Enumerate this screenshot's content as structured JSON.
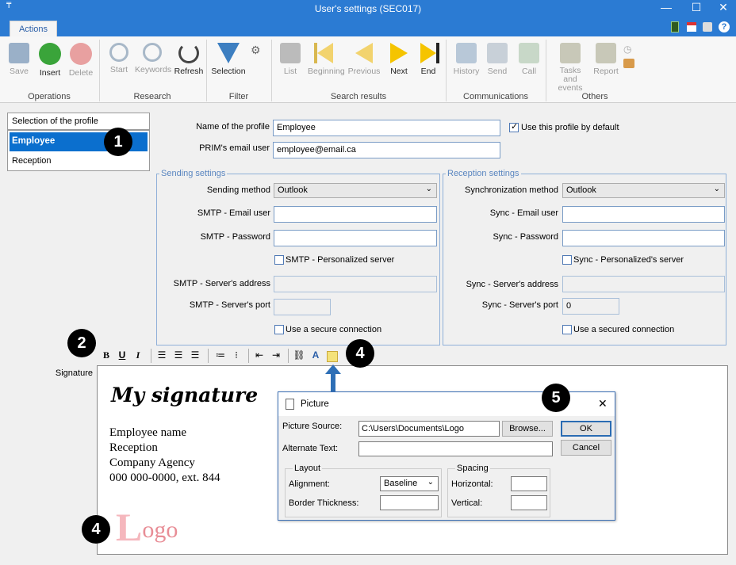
{
  "window": {
    "title": "User's settings (SEC017)",
    "minimize": "—",
    "maximize": "☐",
    "close": "✕"
  },
  "ribbon": {
    "tab": "Actions",
    "buttons": [
      {
        "label": "Save",
        "icon": "save-icon"
      },
      {
        "label": "Insert",
        "icon": "plus-circle-icon"
      },
      {
        "label": "Delete",
        "icon": "x-circle-icon"
      },
      {
        "label": "Start",
        "icon": "magnifier-icon"
      },
      {
        "label": "Keywords",
        "icon": "keyword-search-icon"
      },
      {
        "label": "Refresh",
        "icon": "refresh-icon"
      },
      {
        "label": "Selection",
        "icon": "funnel-icon"
      },
      {
        "label": "List",
        "icon": "scroll-icon"
      },
      {
        "label": "Beginning",
        "icon": "first-icon"
      },
      {
        "label": "Previous",
        "icon": "previous-icon"
      },
      {
        "label": "Next",
        "icon": "next-icon"
      },
      {
        "label": "End",
        "icon": "last-icon"
      },
      {
        "label": "History",
        "icon": "history-icon"
      },
      {
        "label": "Send",
        "icon": "envelope-icon"
      },
      {
        "label": "Call",
        "icon": "phone-icon"
      },
      {
        "label": "Tasks and events",
        "icon": "clipboard-icon"
      },
      {
        "label": "Report",
        "icon": "report-icon"
      }
    ],
    "groups": [
      "Operations",
      "Research",
      "Filter",
      "Search results",
      "Communications",
      "Others"
    ]
  },
  "profiles": {
    "header": "Selection of the profile",
    "items": [
      "Employee",
      "Reception"
    ],
    "selected": "Employee"
  },
  "form": {
    "name_label": "Name of the profile",
    "name_value": "Employee",
    "default_label": "Use this profile by default",
    "email_label": "PRIM's email user",
    "email_value": "employee@email.ca"
  },
  "sending": {
    "legend": "Sending settings",
    "method_label": "Sending method",
    "method_value": "Outlook",
    "user_label": "SMTP - Email user",
    "password_label": "SMTP - Password",
    "personalized_label": "SMTP - Personalized server",
    "address_label": "SMTP - Server's address",
    "port_label": "SMTP - Server's port",
    "secure_label": "Use a secure connection"
  },
  "reception": {
    "legend": "Reception settings",
    "method_label": "Synchronization method",
    "method_value": "Outlook",
    "user_label": "Sync - Email user",
    "password_label": "Sync - Password",
    "personalized_label": "Sync - Personalized's server",
    "address_label": "Sync - Server's address",
    "port_label": "Sync - Server's port",
    "port_value": "0",
    "secure_label": "Use a secured connection"
  },
  "signature": {
    "label": "Signature",
    "heading": "My signature",
    "lines": [
      "Employee name",
      "Reception",
      "Company Agency",
      "000 000-0000, ext. 844"
    ],
    "logo_first": "L",
    "logo_rest": "ogo"
  },
  "toolbar": {
    "bold": "B",
    "underline": "U",
    "italic": "I"
  },
  "dialog": {
    "title": "Picture",
    "source_label": "Picture Source:",
    "source_value": "C:\\Users\\Documents\\Logo",
    "browse": "Browse...",
    "ok": "OK",
    "cancel": "Cancel",
    "alt_label": "Alternate Text:",
    "layout_legend": "Layout",
    "alignment_label": "Alignment:",
    "alignment_value": "Baseline",
    "border_label": "Border Thickness:",
    "spacing_legend": "Spacing",
    "horizontal_label": "Horizontal:",
    "vertical_label": "Vertical:",
    "close": "✕"
  },
  "callouts": [
    "1",
    "2",
    "4",
    "5",
    "4"
  ]
}
